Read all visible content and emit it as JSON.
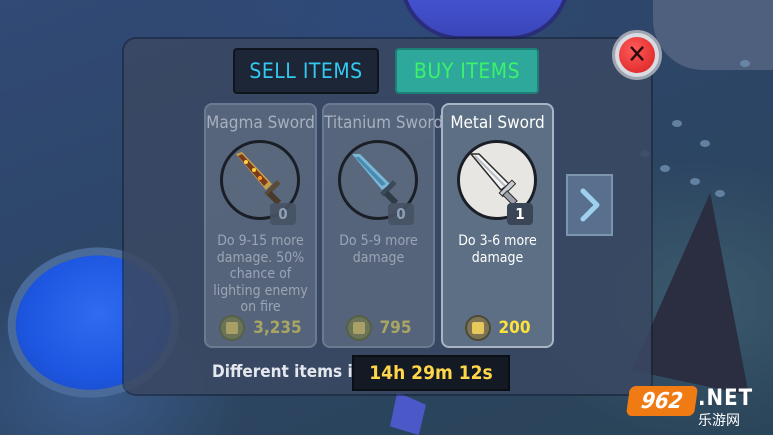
{
  "tabs": {
    "sell": "SELL ITEMS",
    "buy": "BUY ITEMS",
    "active": "buy"
  },
  "close_icon": "close-x-icon",
  "items": [
    {
      "name": "Magma Sword",
      "count": "0",
      "description": "Do 9-15 more damage. 50% chance of lighting enemy on fire",
      "price": "3,235",
      "icon": "magma-sword-icon",
      "selected": false
    },
    {
      "name": "Titanium Sword",
      "count": "0",
      "description": "Do 5-9 more damage",
      "price": "795",
      "icon": "titanium-sword-icon",
      "selected": false
    },
    {
      "name": "Metal Sword",
      "count": "1",
      "description": "Do 3-6 more damage",
      "price": "200",
      "icon": "metal-sword-icon",
      "selected": true
    }
  ],
  "next_icon": "chevron-right-icon",
  "timer": {
    "label": "Different items in:",
    "value": "14h 29m 12s"
  },
  "watermark": {
    "badge": "962",
    "suffix": ".NET",
    "sub": "乐游网"
  },
  "colors": {
    "buy_tab": "#2ea89a",
    "sell_text": "#33c9f0",
    "buy_text": "#3bf26a",
    "price_gold": "#ffe23a",
    "timer_gold": "#ffd54a"
  }
}
